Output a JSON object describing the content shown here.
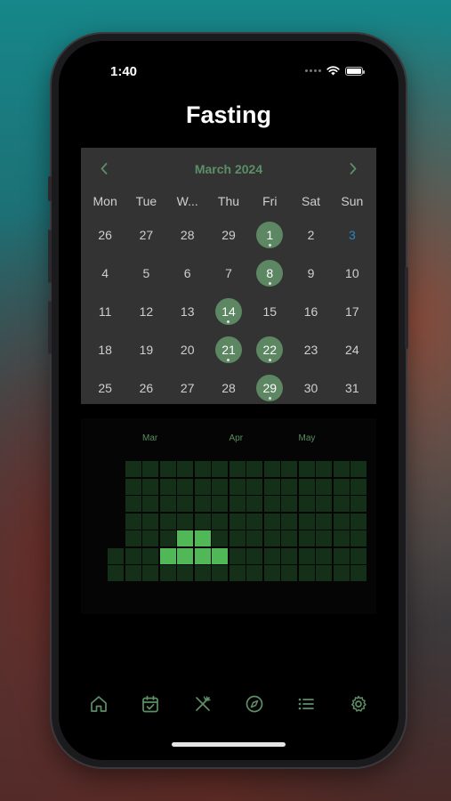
{
  "status": {
    "time": "1:40"
  },
  "title": "Fasting",
  "calendar": {
    "month": "March 2024",
    "weekdays": [
      "Mon",
      "Tue",
      "W...",
      "Thu",
      "Fri",
      "Sat",
      "Sun"
    ],
    "days": [
      {
        "n": "26",
        "fast": false,
        "today": false
      },
      {
        "n": "27",
        "fast": false,
        "today": false
      },
      {
        "n": "28",
        "fast": false,
        "today": false
      },
      {
        "n": "29",
        "fast": false,
        "today": false
      },
      {
        "n": "1",
        "fast": true,
        "today": false
      },
      {
        "n": "2",
        "fast": false,
        "today": false
      },
      {
        "n": "3",
        "fast": false,
        "today": true
      },
      {
        "n": "4",
        "fast": false,
        "today": false
      },
      {
        "n": "5",
        "fast": false,
        "today": false
      },
      {
        "n": "6",
        "fast": false,
        "today": false
      },
      {
        "n": "7",
        "fast": false,
        "today": false
      },
      {
        "n": "8",
        "fast": true,
        "today": false
      },
      {
        "n": "9",
        "fast": false,
        "today": false
      },
      {
        "n": "10",
        "fast": false,
        "today": false
      },
      {
        "n": "11",
        "fast": false,
        "today": false
      },
      {
        "n": "12",
        "fast": false,
        "today": false
      },
      {
        "n": "13",
        "fast": false,
        "today": false
      },
      {
        "n": "14",
        "fast": true,
        "today": false
      },
      {
        "n": "15",
        "fast": false,
        "today": false
      },
      {
        "n": "16",
        "fast": false,
        "today": false
      },
      {
        "n": "17",
        "fast": false,
        "today": false
      },
      {
        "n": "18",
        "fast": false,
        "today": false
      },
      {
        "n": "19",
        "fast": false,
        "today": false
      },
      {
        "n": "20",
        "fast": false,
        "today": false
      },
      {
        "n": "21",
        "fast": true,
        "today": false
      },
      {
        "n": "22",
        "fast": true,
        "today": false
      },
      {
        "n": "23",
        "fast": false,
        "today": false
      },
      {
        "n": "24",
        "fast": false,
        "today": false
      },
      {
        "n": "25",
        "fast": false,
        "today": false
      },
      {
        "n": "26",
        "fast": false,
        "today": false
      },
      {
        "n": "27",
        "fast": false,
        "today": false
      },
      {
        "n": "28",
        "fast": false,
        "today": false
      },
      {
        "n": "29",
        "fast": true,
        "today": false
      },
      {
        "n": "30",
        "fast": false,
        "today": false
      },
      {
        "n": "31",
        "fast": false,
        "today": false
      }
    ]
  },
  "heatmap": {
    "months": [
      {
        "label": "Mar",
        "week": 2
      },
      {
        "label": "Apr",
        "week": 7
      },
      {
        "label": "May",
        "week": 11
      }
    ],
    "weeks": 15,
    "rows": 7,
    "first_col_start_row": 5,
    "filled": [
      [
        3,
        5
      ],
      [
        4,
        4
      ],
      [
        4,
        5
      ],
      [
        5,
        4
      ],
      [
        5,
        5
      ],
      [
        6,
        5
      ]
    ],
    "colors": {
      "empty": "#143018",
      "filled": "#50b856",
      "label": "#5a8f5e"
    }
  },
  "tabbar": {
    "tabs": [
      {
        "name": "tab-home",
        "icon": "home-icon"
      },
      {
        "name": "tab-calendar",
        "icon": "calendar-check-icon"
      },
      {
        "name": "tab-meals",
        "icon": "fork-knife-icon"
      },
      {
        "name": "tab-explore",
        "icon": "compass-icon"
      },
      {
        "name": "tab-list",
        "icon": "list-icon"
      },
      {
        "name": "tab-settings",
        "icon": "gear-icon"
      }
    ]
  },
  "colors": {
    "accent": "#5c8762",
    "today": "#2a84c4"
  }
}
